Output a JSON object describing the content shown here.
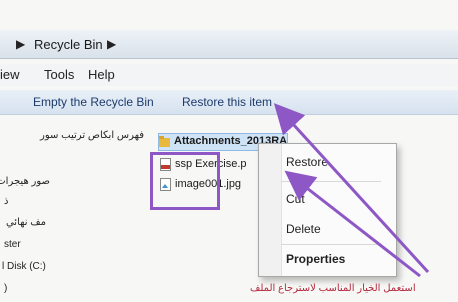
{
  "address_bar": {
    "path": "Recycle Bin"
  },
  "menu": {
    "items": [
      "iew",
      "Tools",
      "Help"
    ]
  },
  "commands": {
    "empty": "Empty the Recycle Bin",
    "restore": "Restore this item"
  },
  "nav": {
    "items": [
      "فهرس ابكاص ترتيب سور",
      "صور هيجرات",
      "ذ",
      "مف نهائي",
      "ster",
      "l Disk (C:)",
      ")"
    ]
  },
  "files": [
    {
      "name": "Attachments_2013RA",
      "icon": "folder-icon",
      "selected": true
    },
    {
      "name": "ssp Exercise.p",
      "icon": "pdf-file-icon",
      "selected": false
    },
    {
      "name": "image001.jpg",
      "icon": "image-file-icon",
      "selected": false
    }
  ],
  "context_menu": {
    "items": [
      {
        "label": "Restore",
        "bold": false
      },
      {
        "label": "Cut",
        "bold": false
      },
      {
        "label": "Delete",
        "bold": false
      },
      {
        "label": "Properties",
        "bold": true
      }
    ]
  },
  "annotation": {
    "caption": "استعمل الخيار المناسب لاسترجاع الملف"
  },
  "colors": {
    "annotation": "#8e57c6",
    "caption": "#b3263a",
    "selection": "#cfe3f7"
  }
}
